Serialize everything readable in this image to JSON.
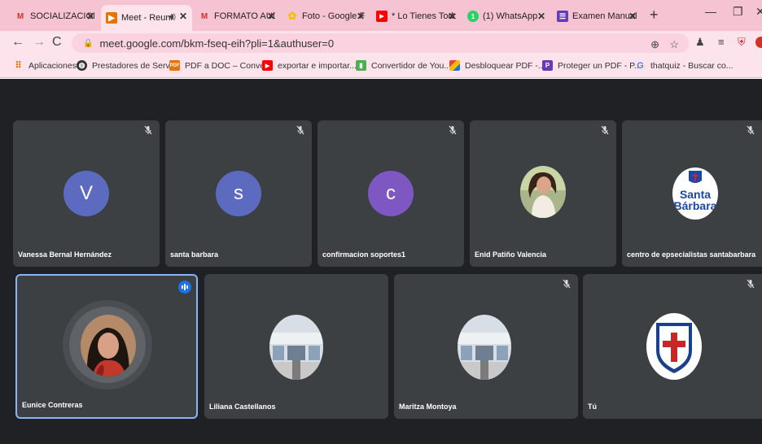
{
  "browser": {
    "tabs": [
      {
        "title": "SOCIALIZACION",
        "icon": "gmail-icon",
        "icon_color": "#d93025"
      },
      {
        "title": "Meet - Reuni",
        "icon": "meet-icon",
        "icon_color": "#e37400",
        "active": true,
        "audio": true
      },
      {
        "title": "FORMATO AUDI",
        "icon": "gmail-icon",
        "icon_color": "#d93025"
      },
      {
        "title": "Foto - Google F",
        "icon": "photos-icon",
        "icon_color": "#fbbc04"
      },
      {
        "title": "* Lo Tienes Todo",
        "icon": "youtube-icon",
        "icon_color": "#ff0000"
      },
      {
        "title": "(1) WhatsApp",
        "icon": "whatsapp-icon",
        "icon_color": "#25d366"
      },
      {
        "title": "Examen Manual",
        "icon": "forms-icon",
        "icon_color": "#673ab7"
      }
    ],
    "url": "meet.google.com/bkm-fseq-eih?pli=1&authuser=0",
    "bookmarks": [
      {
        "label": "Aplicaciones",
        "icon": "apps-icon",
        "color": "#e8710a"
      },
      {
        "label": "Prestadores de Serv...",
        "icon": "globe-icon",
        "color": "#333333"
      },
      {
        "label": "PDF a DOC – Conve...",
        "icon": "pdf-icon",
        "color": "#e8710a"
      },
      {
        "label": "exportar e importar...",
        "icon": "youtube-icon",
        "color": "#ff0000"
      },
      {
        "label": "Convertidor de You...",
        "icon": "converter-icon",
        "color": "#4caf50"
      },
      {
        "label": "Desbloquear PDF -...",
        "icon": "pdf-unlock-icon",
        "color": "#1a73e8"
      },
      {
        "label": "Proteger un PDF - P...",
        "icon": "pdf-protect-icon",
        "color": "#673ab7"
      },
      {
        "label": "thatquiz - Buscar co...",
        "icon": "google-icon",
        "color": "#4285f4"
      }
    ]
  },
  "participants": [
    {
      "name": "Vanessa Bernal Hernández",
      "type": "letter",
      "letter": "V",
      "color": "#5c6bc0",
      "muted": true
    },
    {
      "name": "santa barbara",
      "type": "letter",
      "letter": "s",
      "color": "#5c6bc0",
      "muted": true
    },
    {
      "name": "confirmacion soportes1",
      "type": "letter",
      "letter": "c",
      "color": "#7e57c2",
      "muted": true
    },
    {
      "name": "Enid Patiño Valencia",
      "type": "photo",
      "muted": true
    },
    {
      "name": "centro de epsecialistas santabarbara",
      "type": "logo",
      "logo_text_1": "Santa",
      "logo_text_2": "Bárbara",
      "muted": true
    },
    {
      "name": "Eunice Contreras",
      "type": "photo",
      "speaking": true
    },
    {
      "name": "Liliana Castellanos",
      "type": "building",
      "muted": false
    },
    {
      "name": "Maritza Montoya",
      "type": "building",
      "muted": true
    },
    {
      "name": "Tú",
      "type": "shield",
      "muted": true
    }
  ]
}
